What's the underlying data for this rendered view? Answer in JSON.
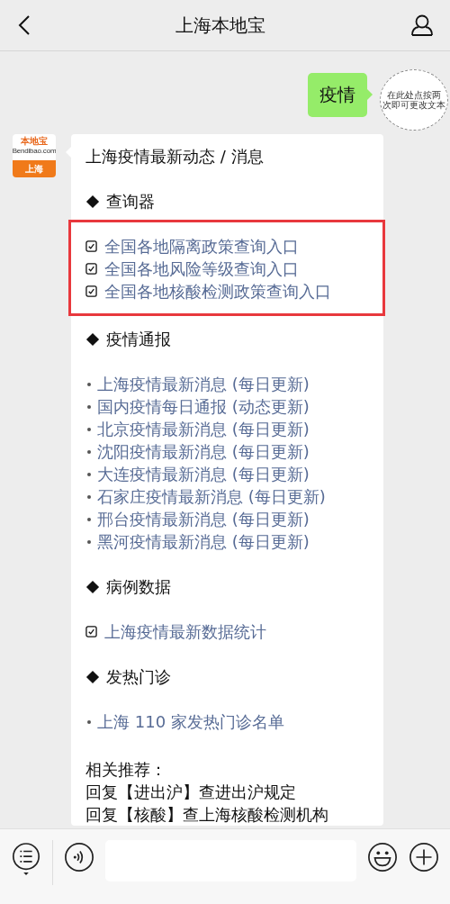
{
  "header": {
    "title": "上海本地宝"
  },
  "sent_message": {
    "text": "疫情"
  },
  "sticker": {
    "lines": [
      "在此处点按两",
      "次即可更改文本"
    ]
  },
  "avatar": {
    "brand": "本地宝",
    "domain": "Bendibao.com",
    "city": "上海"
  },
  "card": {
    "title": "上海疫情最新动态 / 消息",
    "sections": [
      {
        "heading": "查询器",
        "highlighted": true,
        "items": [
          {
            "kind": "check",
            "text": "全国各地隔离政策查询入口"
          },
          {
            "kind": "check",
            "text": "全国各地风险等级查询入口"
          },
          {
            "kind": "check",
            "text": "全国各地核酸检测政策查询入口"
          }
        ]
      },
      {
        "heading": "疫情通报",
        "highlighted": false,
        "items": [
          {
            "kind": "bullet",
            "text": "上海疫情最新消息 (每日更新)"
          },
          {
            "kind": "bullet",
            "text": "国内疫情每日通报 (动态更新)"
          },
          {
            "kind": "bullet",
            "text": "北京疫情最新消息 (每日更新)"
          },
          {
            "kind": "bullet",
            "text": "沈阳疫情最新消息 (每日更新)"
          },
          {
            "kind": "bullet",
            "text": "大连疫情最新消息 (每日更新)"
          },
          {
            "kind": "bullet",
            "text": "石家庄疫情最新消息 (每日更新)"
          },
          {
            "kind": "bullet",
            "text": "邢台疫情最新消息 (每日更新)"
          },
          {
            "kind": "bullet",
            "text": "黑河疫情最新消息 (每日更新)"
          }
        ]
      },
      {
        "heading": "病例数据",
        "highlighted": false,
        "items": [
          {
            "kind": "check",
            "text": "上海疫情最新数据统计"
          }
        ]
      },
      {
        "heading": "发热门诊",
        "highlighted": false,
        "items": [
          {
            "kind": "bullet",
            "text": "上海 110 家发热门诊名单"
          }
        ]
      }
    ],
    "footer": [
      "相关推荐：",
      "回复【进出沪】查进出沪规定",
      "回复【核酸】查上海核酸检测机构"
    ]
  }
}
